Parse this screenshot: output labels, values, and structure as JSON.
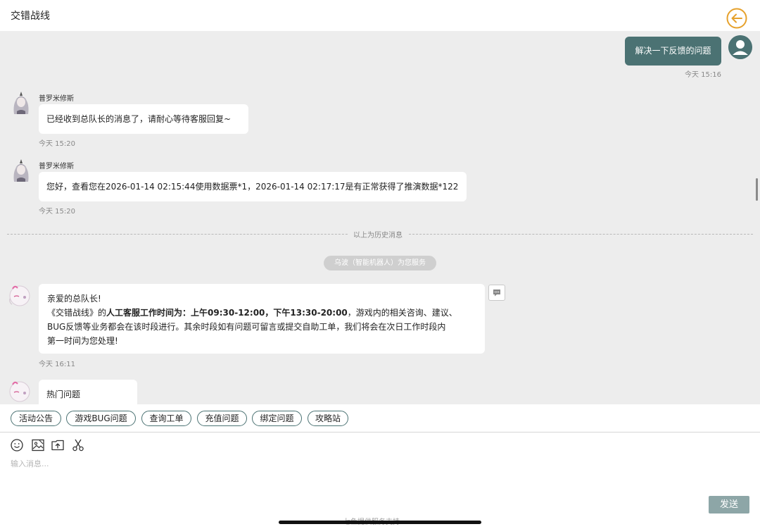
{
  "header": {
    "title": "交错战线"
  },
  "messages": {
    "user_message": "解决一下反馈的问题",
    "user_time": "今天 15:16",
    "agent1_name": "普罗米修斯",
    "agent1_text": "已经收到总队长的消息了，请耐心等待客服回复~",
    "agent1_time": "今天 15:20",
    "agent2_name": "普罗米修斯",
    "agent2_text": "您好，查看您在2026-01-14 02:15:44使用数据票*1，2026-01-14 02:17:17是有正常获得了推演数据*122",
    "agent2_time": "今天 15:20",
    "history_divider": "以上为历史消息",
    "service_notice": "乌波（智能机器人）为您服务",
    "bot_greeting": "亲爱的总队长!",
    "bot_line2_prefix": "《交错战线》的",
    "bot_line2_bold": "人工客服工作时间为：上午09:30-12:00，下午13:30-20:00",
    "bot_line2_suffix": "，游戏内的相关咨询、建议、",
    "bot_line3": "BUG反馈等业务都会在该时段进行。其余时段如有问题可留言或提交自助工单，我们将会在次日工作时段内",
    "bot_line4": "第一时间为您处理!",
    "bot_time": "今天 16:11",
    "hot_questions": "热门问题"
  },
  "quick_replies": [
    "活动公告",
    "游戏BUG问题",
    "查询工单",
    "充值问题",
    "绑定问题",
    "攻略站"
  ],
  "input": {
    "placeholder": "输入消息...",
    "send_label": "发送",
    "footer": "七鱼提供服务支持"
  },
  "icons": {
    "back": "back-arrow-icon",
    "user_avatar": "user-avatar-icon",
    "emoji": "emoji-icon",
    "image": "image-icon",
    "upload": "upload-file-icon",
    "screenshot": "scissors-icon",
    "message": "message-icon"
  },
  "colors": {
    "accent": "#4b7273",
    "back_button": "#e6a12c",
    "chat_background": "#ededed",
    "send_button": "#8da6a7"
  }
}
